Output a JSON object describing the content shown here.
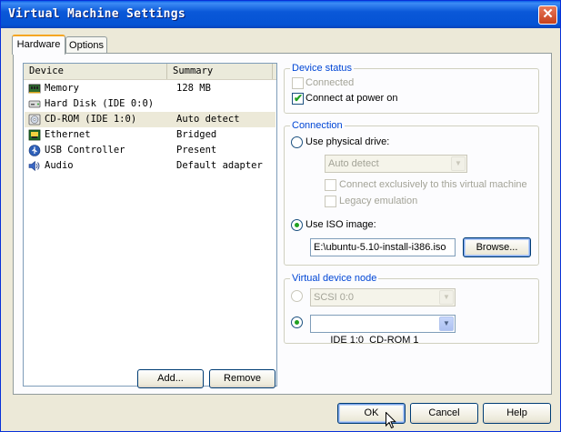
{
  "window": {
    "title": "Virtual Machine Settings",
    "close_glyph": "✕"
  },
  "tabs": [
    {
      "label": "Hardware",
      "active": true
    },
    {
      "label": "Options",
      "active": false
    }
  ],
  "device_list": {
    "columns": [
      "Device",
      "Summary"
    ],
    "rows": [
      {
        "device": "Memory",
        "summary": "128 MB",
        "icon": "memory-icon",
        "selected": false
      },
      {
        "device": "Hard Disk (IDE 0:0)",
        "summary": "",
        "icon": "hard-disk-icon",
        "selected": false
      },
      {
        "device": "CD-ROM (IDE 1:0)",
        "summary": "Auto detect",
        "icon": "cdrom-icon",
        "selected": true
      },
      {
        "device": "Ethernet",
        "summary": "Bridged",
        "icon": "ethernet-icon",
        "selected": false
      },
      {
        "device": "USB Controller",
        "summary": "Present",
        "icon": "usb-icon",
        "selected": false
      },
      {
        "device": "Audio",
        "summary": "Default adapter",
        "icon": "audio-icon",
        "selected": false
      }
    ]
  },
  "list_buttons": {
    "add": "Add...",
    "remove": "Remove"
  },
  "device_status": {
    "title": "Device status",
    "connected": {
      "label": "Connected",
      "checked": false,
      "enabled": false
    },
    "connect_at_power_on": {
      "label": "Connect at power on",
      "checked": true,
      "enabled": true
    }
  },
  "connection": {
    "title": "Connection",
    "use_physical_drive": {
      "label": "Use physical drive:",
      "selected": false
    },
    "drive_combo": {
      "value": "Auto detect",
      "enabled": false
    },
    "connect_exclusively": {
      "label": "Connect exclusively to this virtual machine",
      "checked": false,
      "enabled": false
    },
    "legacy_emulation": {
      "label": "Legacy emulation",
      "checked": false,
      "enabled": false
    },
    "use_iso_image": {
      "label": "Use ISO image:",
      "selected": true
    },
    "iso_path": "E:\\ubuntu-5.10-install-i386.iso",
    "browse_label": "Browse..."
  },
  "virtual_device_node": {
    "title": "Virtual device node",
    "scsi": {
      "value": "SCSI 0:0",
      "selected": false,
      "enabled": false
    },
    "ide": {
      "value": "IDE 1:0  CD-ROM 1",
      "selected": true,
      "enabled": true
    }
  },
  "dialog_buttons": {
    "ok": "OK",
    "cancel": "Cancel",
    "help": "Help"
  },
  "colors": {
    "accent": "#0046d5",
    "check": "#21a121",
    "titlebar": "#0553d4"
  }
}
